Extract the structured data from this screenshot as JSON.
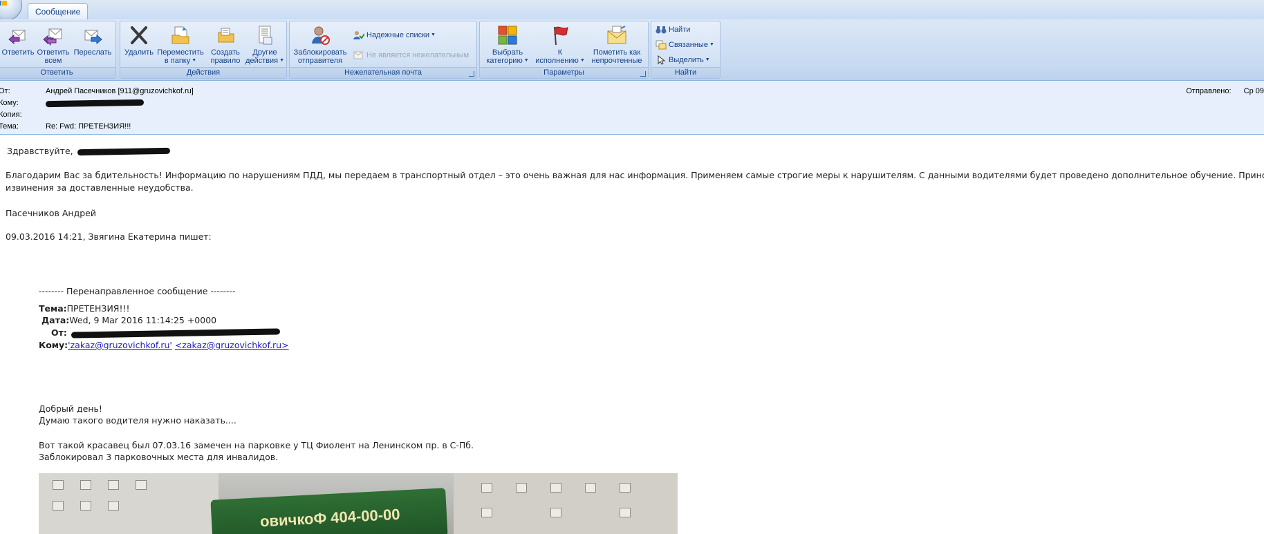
{
  "window": {
    "tab_label": "Сообщение"
  },
  "ribbon": {
    "groups": {
      "reply": {
        "title": "Ответить",
        "reply": "Ответить",
        "reply_all_1": "Ответить",
        "reply_all_2": "всем",
        "forward": "Переслать"
      },
      "actions": {
        "title": "Действия",
        "delete": "Удалить",
        "move_1": "Переместить",
        "move_2": "в папку",
        "rule_1": "Создать",
        "rule_2": "правило",
        "other_1": "Другие",
        "other_2": "действия"
      },
      "junk": {
        "title": "Нежелательная почта",
        "block_1": "Заблокировать",
        "block_2": "отправителя",
        "safe_lists": "Надежные списки",
        "not_junk": "Не является нежелательным"
      },
      "options": {
        "title": "Параметры",
        "category_1": "Выбрать",
        "category_2": "категорию",
        "followup_1": "К",
        "followup_2": "исполнению",
        "unread_1": "Пометить как",
        "unread_2": "непрочтенные"
      },
      "find": {
        "title": "Найти",
        "find": "Найти",
        "related": "Связанные",
        "select": "Выделить"
      }
    }
  },
  "header": {
    "from_label": "От:",
    "from_value": "Андрей Пасечников [911@gruzovichkof.ru]",
    "to_label": "Кому:",
    "cc_label": "Копия:",
    "subject_label": "Тема:",
    "subject_value": "Re: Fwd: ПРЕТЕНЗИЯ!!!",
    "sent_label": "Отправлено:",
    "sent_value": "Ср 09"
  },
  "message": {
    "greeting": "Здравствуйте,",
    "para1_line1": "Благодарим Вас за бдительность! Информацию по нарушениям ПДД, мы передаем в транспортный отдел – это очень важная для нас информация. Применяем самые строгие меры к нарушителям. С данными водителями будет проведено дополнительное обучение. Приносим свои",
    "para1_line2": "извинения за доставленные неудобства.",
    "signature": "Пасечников Андрей",
    "quote_intro": "09.03.2016 14:21, Звягина Екатерина пишет:",
    "forwarded_header": "-------- Перенаправленное сообщение --------",
    "fwd_subject_label": "Тема:",
    "fwd_subject_value": "ПРЕТЕНЗИЯ!!!",
    "fwd_date_label": "Дата:",
    "fwd_date_value": "Wed, 9 Mar 2016 11:14:25 +0000",
    "fwd_from_label": "От:",
    "fwd_to_label": "Кому:",
    "fwd_to_link1": "'zakaz@gruzovichkof.ru'",
    "fwd_to_link2": "<zakaz@gruzovichkof.ru>",
    "body_line1": "Добрый день!",
    "body_line2": "Думаю такого водителя нужно наказать....",
    "body_line3": "Вот такой красавец был 07.03.16 замечен на парковке у ТЦ Фиолент на Ленинском пр. в С-Пб.",
    "body_line4": "Заблокировал 3 парковочных места для инвалидов.",
    "photo_text": "овичкоФ  404-00-00"
  }
}
